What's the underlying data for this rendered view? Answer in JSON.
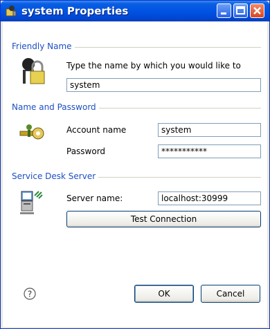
{
  "window": {
    "title": "system Properties"
  },
  "friendly": {
    "group_label": "Friendly Name",
    "prompt": "Type the name by which you would like to",
    "name_value": "system"
  },
  "credentials": {
    "group_label": "Name and Password",
    "account_label": "Account name",
    "account_value": "system",
    "password_label": "Password",
    "password_value": "***********"
  },
  "server": {
    "group_label": "Service Desk Server",
    "server_label": "Server name:",
    "server_value": "localhost:30999",
    "test_button": "Test Connection"
  },
  "footer": {
    "help_glyph": "?",
    "ok": "OK",
    "cancel": "Cancel"
  },
  "colors": {
    "accent": "#1d4fc3",
    "titlebar": "#0054e3"
  },
  "icons": [
    "person-lock-icon",
    "key-icon",
    "server-computer-icon",
    "help-icon"
  ]
}
